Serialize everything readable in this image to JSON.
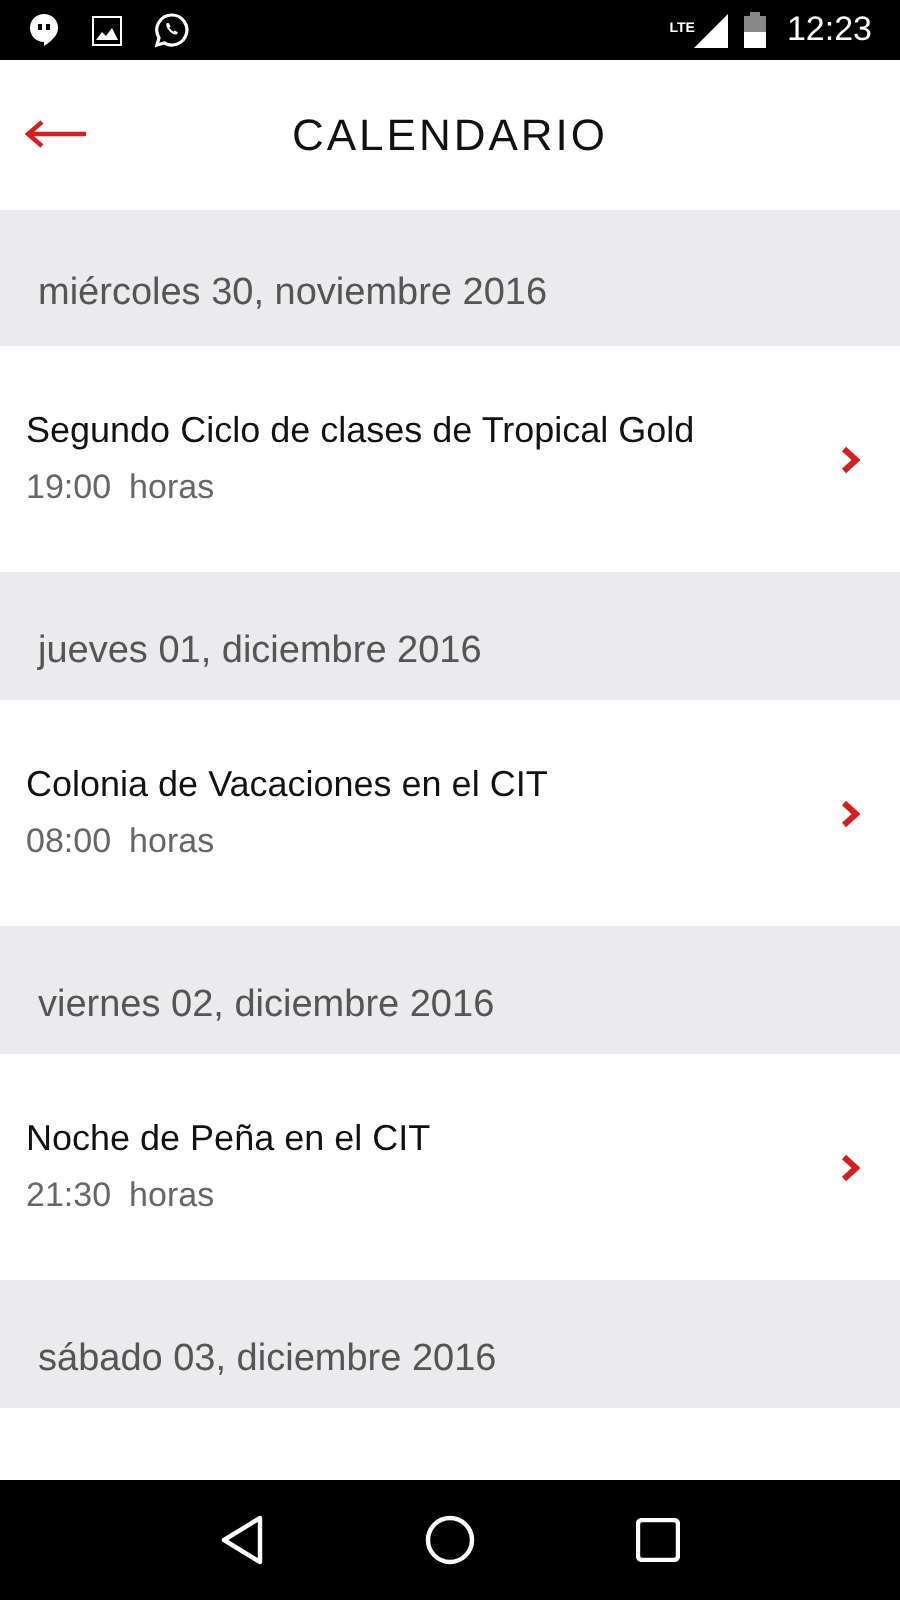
{
  "status_bar": {
    "network": "LTE",
    "time": "12:23"
  },
  "header": {
    "title": "CALENDARIO"
  },
  "days": [
    {
      "date": "miércoles 30, noviembre 2016",
      "events": [
        {
          "title": "Segundo Ciclo de clases de Tropical Gold",
          "time": "19:00",
          "unit": "horas"
        }
      ]
    },
    {
      "date": "jueves 01, diciembre 2016",
      "events": [
        {
          "title": "Colonia de Vacaciones en el CIT",
          "time": "08:00",
          "unit": "horas"
        }
      ]
    },
    {
      "date": "viernes 02, diciembre 2016",
      "events": [
        {
          "title": "Noche de Peña en el CIT",
          "time": "21:30",
          "unit": "horas"
        }
      ]
    },
    {
      "date": "sábado 03, diciembre 2016"
    }
  ]
}
